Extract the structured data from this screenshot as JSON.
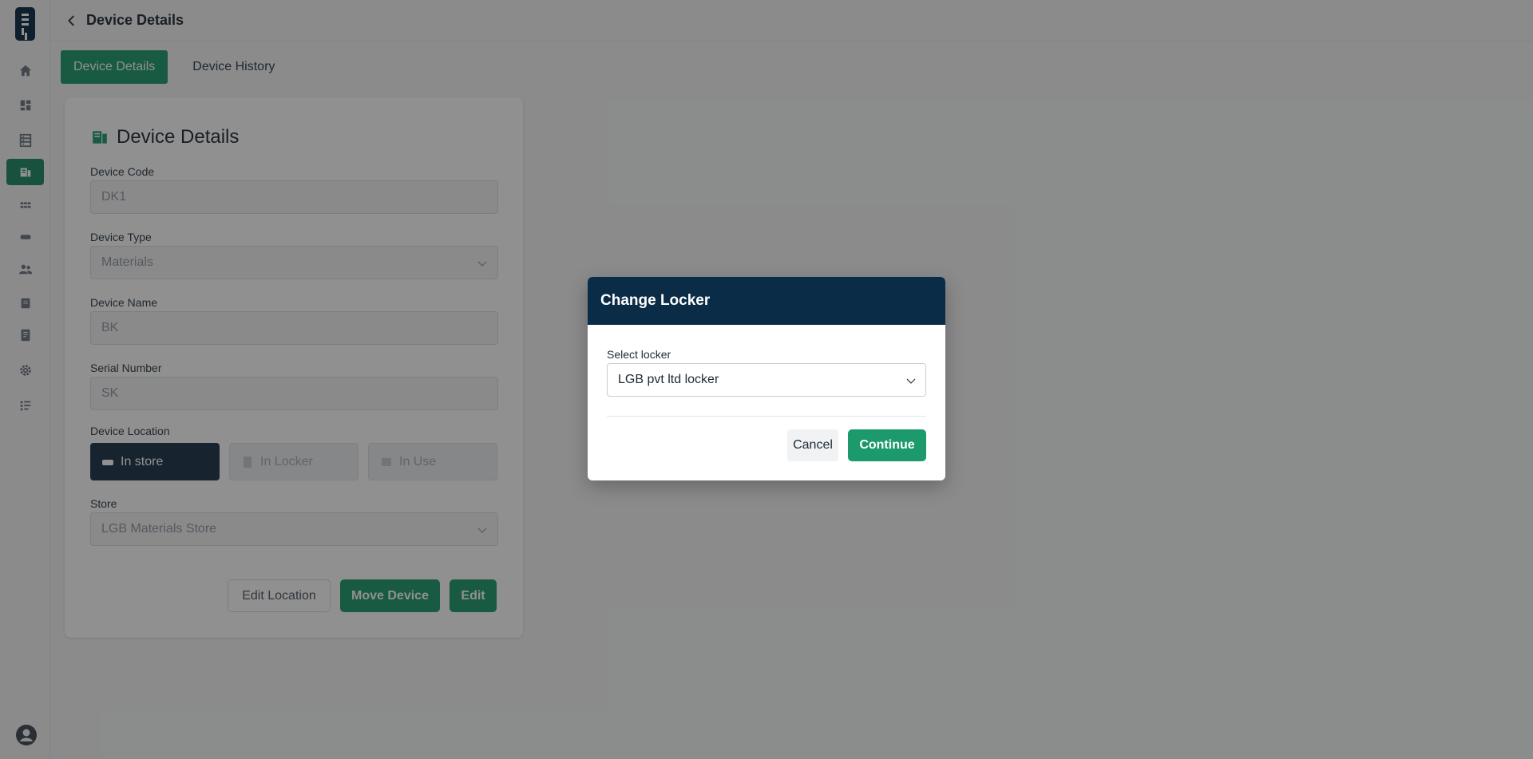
{
  "header": {
    "title": "Device Details"
  },
  "tabs": [
    {
      "label": "Device Details",
      "active": true
    },
    {
      "label": "Device History",
      "active": false
    }
  ],
  "card": {
    "title": "Device Details",
    "fields": {
      "device_code": {
        "label": "Device Code",
        "value": "DK1"
      },
      "device_type": {
        "label": "Device Type",
        "value": "Materials"
      },
      "device_name": {
        "label": "Device Name",
        "value": "BK"
      },
      "serial_number": {
        "label": "Serial Number",
        "value": "SK"
      },
      "store": {
        "label": "Store",
        "value": "LGB Materials Store"
      }
    },
    "location": {
      "label": "Device Location",
      "options": [
        {
          "label": "In store",
          "selected": true
        },
        {
          "label": "In Locker",
          "selected": false
        },
        {
          "label": "In Use",
          "selected": false
        }
      ]
    },
    "buttons": {
      "edit_location": "Edit Location",
      "move_device": "Move Device",
      "edit": "Edit"
    }
  },
  "sidebar": {
    "items": [
      {
        "icon": "home-icon"
      },
      {
        "icon": "dashboard-icon"
      },
      {
        "icon": "inventory-icon"
      },
      {
        "icon": "devices-icon",
        "active": true
      },
      {
        "icon": "grid-icon"
      },
      {
        "icon": "tag-icon"
      },
      {
        "icon": "users-icon"
      },
      {
        "icon": "locker-icon"
      },
      {
        "icon": "report-icon"
      },
      {
        "icon": "settings-icon"
      },
      {
        "icon": "list-icon"
      }
    ]
  },
  "modal": {
    "title": "Change Locker",
    "select_label": "Select locker",
    "selected_value": "LGB pvt ltd locker",
    "cancel_label": "Cancel",
    "continue_label": "Continue"
  },
  "colors": {
    "accent": "#1d9a6c",
    "navy": "#0b2c47",
    "selected_location": "#1b3449"
  }
}
